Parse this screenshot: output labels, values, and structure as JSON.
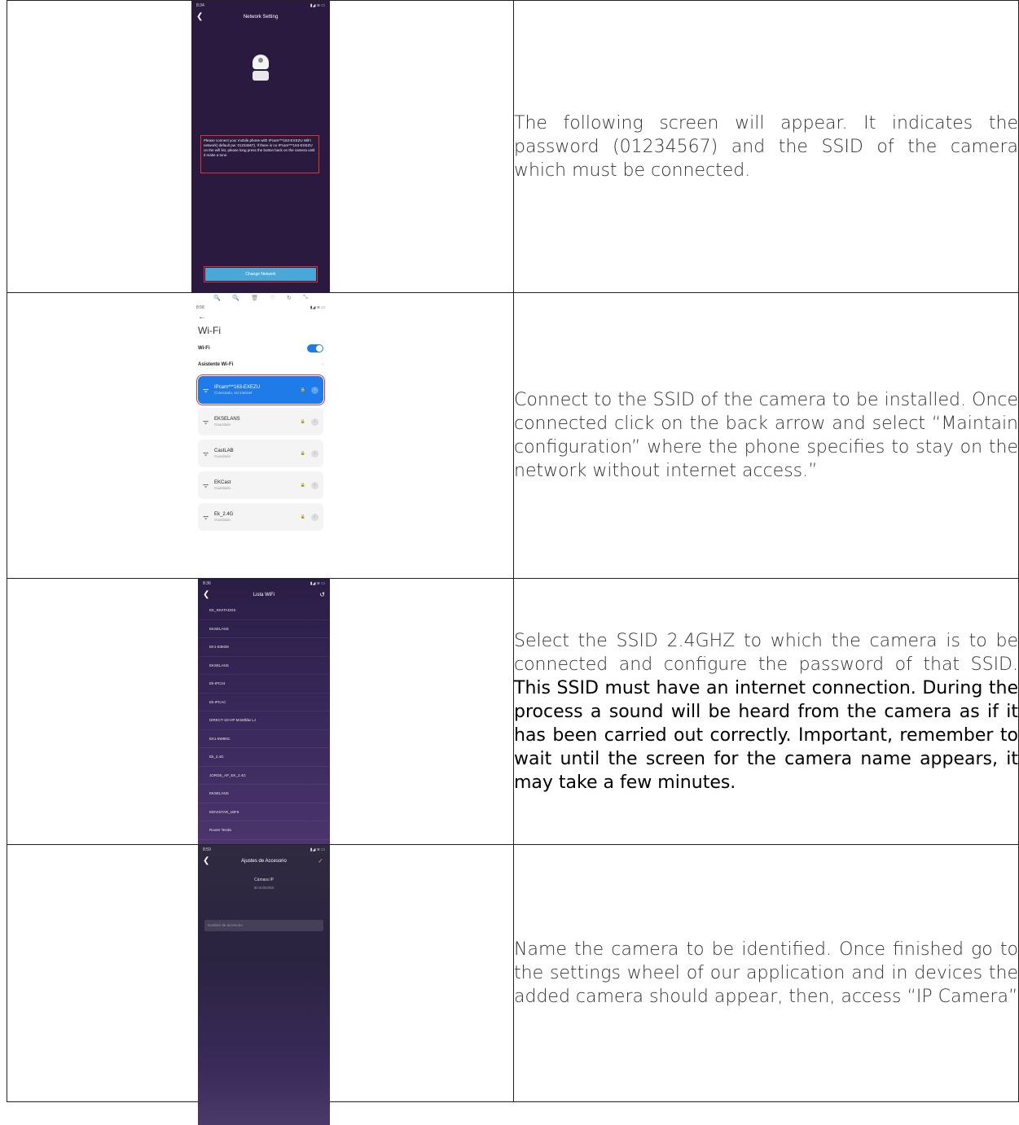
{
  "rows": [
    {
      "phone": {
        "status_time": "8:34",
        "status_icons": "▮◢ ≋ ▭",
        "title": "Network Setting",
        "message": "Please connect your mobile phone with IPcam***163-EXEZU WiFi network( default pw: 01234567). If there is no IPcam***163-EXEZU on the wifi list, please long press the button back on the camera until it make a tone.",
        "button": "Change Network"
      },
      "text": "The following screen will appear. It indicates the password (01234567) and the SSID of the camera which must be connected."
    },
    {
      "phone": {
        "toolbar": [
          "🔍",
          "🔍",
          "🗑",
          "♡",
          "↻",
          "⤡"
        ],
        "status_time": "8:58",
        "status_icons": "▮◢ ≋ ▭",
        "back": "←",
        "title": "Wi-Fi",
        "wifi_label": "Wi-Fi",
        "assistant_label": "Asistente Wi-Fi",
        "networks": [
          {
            "name": "IPcam***163-EXEZU",
            "status": "Conectado, sin internet"
          },
          {
            "name": "EKSELANS",
            "status": "Guardado"
          },
          {
            "name": "CastLAB",
            "status": "Guardado"
          },
          {
            "name": "EKCast",
            "status": "Guardado"
          },
          {
            "name": "Ek_2.4G",
            "status": "Guardado"
          }
        ]
      },
      "text": "Connect to the SSID of the camera to be installed. Once connected click on the back arrow and select “Maintain configuration” where the phone specifies to stay on the network without internet access.”"
    },
    {
      "phone": {
        "status_time": "8:36",
        "status_icons": "▮◢ ≋ ▭",
        "title": "Lista WiFi",
        "ssids": [
          "EK_INVITADOS",
          "EKSELANS",
          "EK1-83M39",
          "EKSELANS",
          "Ek-IPC24",
          "Ek-IPCAC",
          "DIRECT-1D-HP M428fdw LJ",
          "EK1-9W9NC",
          "Ek_2.4G",
          "JORGE_AP_EK_2.4G",
          "EKSELANS",
          "MOVISTAR_1BF6",
          "Router Tenda"
        ]
      },
      "text_light": "Select the SSID 2.4GHZ to which the camera is to be connected and configure the password of that SSID.",
      "text_strong": "This SSID must have an internet connection. During the process a sound will be heard from the camera as if it has been carried out correctly. Important, remember to wait until the screen for the camera name appears, it may take a few minutes."
    },
    {
      "phone": {
        "status_time": "8:59",
        "status_icons": "▮◢ ≋ ▭",
        "title": "Ajustes de Accesorio",
        "check": "✓",
        "camera_label": "Cámara IP",
        "camera_id": "ID:9r4lx0hW",
        "name_placeholder": "Nombre de accesorio"
      },
      "text": "Name the camera to be identified. Once finished go to the settings wheel of our application and in devices the added camera should appear, then, access “IP Camera”"
    }
  ]
}
